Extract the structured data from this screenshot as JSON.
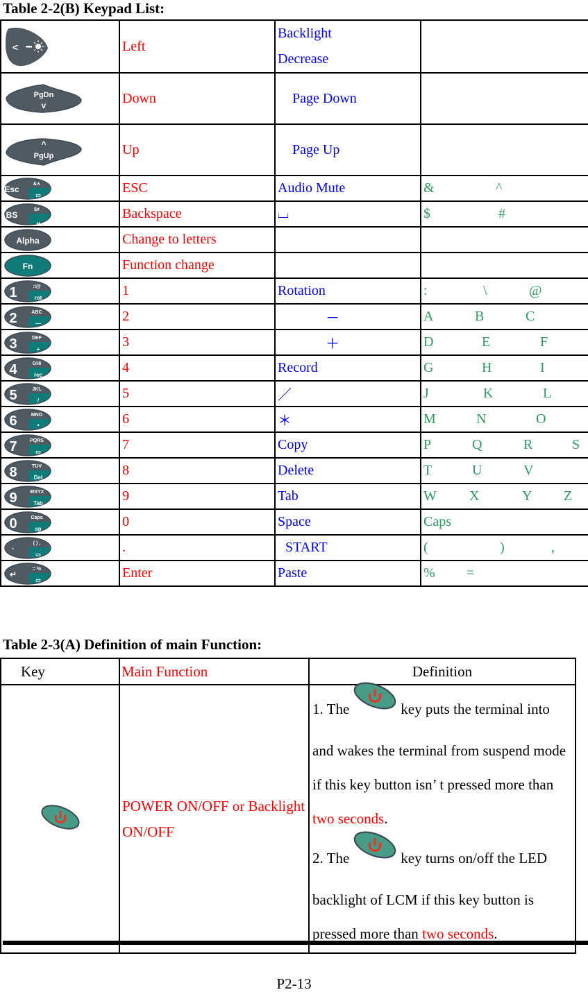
{
  "keypad_table": {
    "title": "Table 2-2(B) Keypad List:",
    "rows": [
      {
        "key": "left-key",
        "key_labels": {
          "main": "<",
          "sub": "-☀"
        },
        "primary": "Left",
        "secondary_lines": [
          "Backlight",
          "Decrease"
        ],
        "alt": []
      },
      {
        "key": "pgdn-key",
        "key_labels": {
          "main": "PgDn",
          "sub": "v"
        },
        "primary": "Down",
        "secondary": "Page Down",
        "alt": []
      },
      {
        "key": "pgup-key",
        "key_labels": {
          "main": "^",
          "sub": "PgUp"
        },
        "primary": "Up",
        "secondary": "Page Up",
        "alt": []
      },
      {
        "key": "esc-key",
        "key_labels": {
          "main": "Esc",
          "top": "&∧",
          "fn": "mute"
        },
        "primary": "ESC",
        "secondary": "Audio Mute",
        "alt": [
          "&",
          "^"
        ]
      },
      {
        "key": "bs-key",
        "key_labels": {
          "main": "BS",
          "top": "$#",
          "fn": "␣"
        },
        "primary": "Backspace",
        "secondary": "⌴",
        "alt": [
          "$",
          "#"
        ]
      },
      {
        "key": "alpha-key",
        "key_labels": {
          "main": "Alpha"
        },
        "primary": "Change to letters",
        "secondary": "",
        "alt": []
      },
      {
        "key": "fn-key",
        "key_labels": {
          "main": "Fn"
        },
        "primary": "Function change",
        "secondary": "",
        "alt": []
      },
      {
        "key": "key-1",
        "key_labels": {
          "main": "1",
          "top": ":\\@",
          "fn": "rot"
        },
        "primary": "1",
        "secondary": "Rotation",
        "alt": [
          ":",
          "\\",
          "@"
        ]
      },
      {
        "key": "key-2",
        "key_labels": {
          "main": "2",
          "top": "ABC",
          "fn": "—"
        },
        "primary": "2",
        "secondary": "－",
        "alt": [
          "A",
          "B",
          "C"
        ]
      },
      {
        "key": "key-3",
        "key_labels": {
          "main": "3",
          "top": "DEF",
          "fn": "+"
        },
        "primary": "3",
        "secondary": "＋",
        "alt": [
          "D",
          "E",
          "F"
        ]
      },
      {
        "key": "key-4",
        "key_labels": {
          "main": "4",
          "top": "GHI",
          "fn": "rec"
        },
        "primary": "4",
        "secondary": "Record",
        "alt": [
          "G",
          "H",
          "I"
        ]
      },
      {
        "key": "key-5",
        "key_labels": {
          "main": "5",
          "top": "JKL",
          "fn": "/"
        },
        "primary": "5",
        "secondary": "／",
        "alt": [
          "J",
          "K",
          "L"
        ]
      },
      {
        "key": "key-6",
        "key_labels": {
          "main": "6",
          "top": "MNO",
          "fn": "*"
        },
        "primary": "6",
        "secondary": "＊",
        "alt": [
          "M",
          "N",
          "O"
        ]
      },
      {
        "key": "key-7",
        "key_labels": {
          "main": "7",
          "top": "PQRS",
          "fn": "copy"
        },
        "primary": "7",
        "secondary": "Copy",
        "alt": [
          "P",
          "Q",
          "R",
          "S"
        ]
      },
      {
        "key": "key-8",
        "key_labels": {
          "main": "8",
          "top": "TUV",
          "fn": "Del"
        },
        "primary": "8",
        "secondary": "Delete",
        "alt": [
          "T",
          "U",
          "V"
        ]
      },
      {
        "key": "key-9",
        "key_labels": {
          "main": "9",
          "top": "WXYZ",
          "fn": "Tab"
        },
        "primary": "9",
        "secondary": "Tab",
        "alt": [
          "W",
          "X",
          "Y",
          "Z"
        ]
      },
      {
        "key": "key-0",
        "key_labels": {
          "main": "0",
          "top": "Caps",
          "fn": "sp"
        },
        "primary": "0",
        "secondary": "Space",
        "alt": [
          "Caps"
        ]
      },
      {
        "key": "key-dot",
        "key_labels": {
          "main": "·",
          "top": "( ) ,",
          "fn": "start"
        },
        "primary": ".",
        "secondary": "START",
        "alt": [
          "(",
          ")",
          ","
        ]
      },
      {
        "key": "key-enter",
        "key_labels": {
          "main": "↵",
          "top": "= %",
          "fn": "paste"
        },
        "primary": "Enter",
        "secondary": "Paste",
        "alt": [
          "%",
          "="
        ]
      }
    ]
  },
  "main_function_table": {
    "title": "Table 2-3(A) Definition of main Function:",
    "headers": {
      "key": "Key",
      "main": "Main Function",
      "definition": "Definition"
    },
    "row": {
      "key_icon": "power-key",
      "main_function": "POWER ON/OFF or Backlight ON/OFF",
      "definition": {
        "p1_prefix": "1. The",
        "p1_text": "key puts the terminal into and wakes the terminal from suspend mode if this key button isn’ t pressed more than",
        "p1_emph": "two seconds",
        "p1_end": ".",
        "p2_prefix": "2. The",
        "p2_text": "key turns on/off the LED backlight of LCM if this key button is pressed more than",
        "p2_emph": "two seconds",
        "p2_end": "."
      }
    }
  },
  "footer": {
    "page_number": "P2-13"
  },
  "colors": {
    "primary_text": "#ff0000",
    "secondary_text": "#0000ff",
    "alt_text": "#2e9a5e",
    "key_body": "#4f5a63",
    "key_fn": "#0f7c7a",
    "power_key": "#479b87",
    "power_icon": "#e03a2a"
  }
}
